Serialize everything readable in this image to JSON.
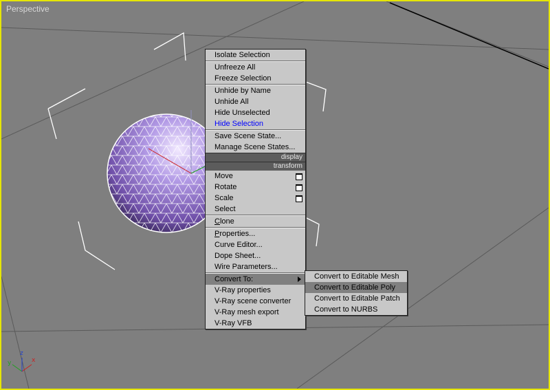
{
  "viewport": {
    "label": "Perspective"
  },
  "axis_tripod": {
    "x": "x",
    "y": "y",
    "z": "z"
  },
  "quad_menu": {
    "groups": [
      [
        "Isolate Selection"
      ],
      [
        "Unfreeze All",
        "Freeze Selection"
      ],
      [
        "Unhide by Name",
        "Unhide All",
        "Hide Unselected",
        "Hide Selection"
      ],
      [
        "Save Scene State...",
        "Manage Scene States..."
      ]
    ],
    "header_display": "display",
    "header_transform": "transform",
    "transform_items": [
      "Move",
      "Rotate",
      "Scale",
      "Select"
    ],
    "clone": "Clone",
    "clone_underline": "C",
    "clone_rest": "lone",
    "props": [
      "Properties...",
      "Curve Editor...",
      "Dope Sheet...",
      "Wire Parameters..."
    ],
    "props_underline": "P",
    "props_rest": "roperties...",
    "convert_to": "Convert To:",
    "vray": [
      "V-Ray properties",
      "V-Ray scene converter",
      "V-Ray mesh export",
      "V-Ray VFB"
    ]
  },
  "submenu": {
    "items": [
      "Convert to Editable Mesh",
      "Convert to Editable Poly",
      "Convert to Editable Patch",
      "Convert to NURBS"
    ],
    "active_index": 1
  },
  "colors": {
    "viewport_border": "#e6e600",
    "sphere": "#9b7fd4",
    "highlight_text": "#0000ff"
  }
}
